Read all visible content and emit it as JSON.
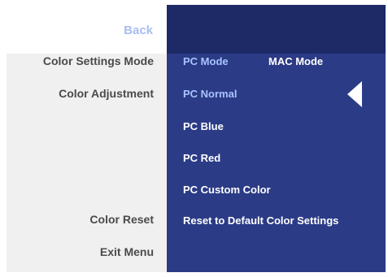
{
  "left": {
    "back": "Back",
    "color_settings_mode": "Color Settings Mode",
    "color_adjustment": "Color Adjustment",
    "color_reset": "Color Reset",
    "exit_menu": "Exit Menu"
  },
  "right": {
    "pc_mode": "PC Mode",
    "mac_mode": "MAC Mode",
    "pc_normal": "PC Normal",
    "pc_blue": "PC Blue",
    "pc_red": "PC Red",
    "pc_custom_color": "PC Custom Color",
    "reset_default": "Reset to Default Color Settings"
  },
  "colors": {
    "right_header_bg": "#1d2a66",
    "right_panel_bg": "#2b3b86",
    "left_panel_bg": "#f0f0f0",
    "selected_text": "#a9c4ff",
    "back_text": "#a9bdf0"
  },
  "icons": {
    "selection_arrow": "arrow-left-icon"
  }
}
